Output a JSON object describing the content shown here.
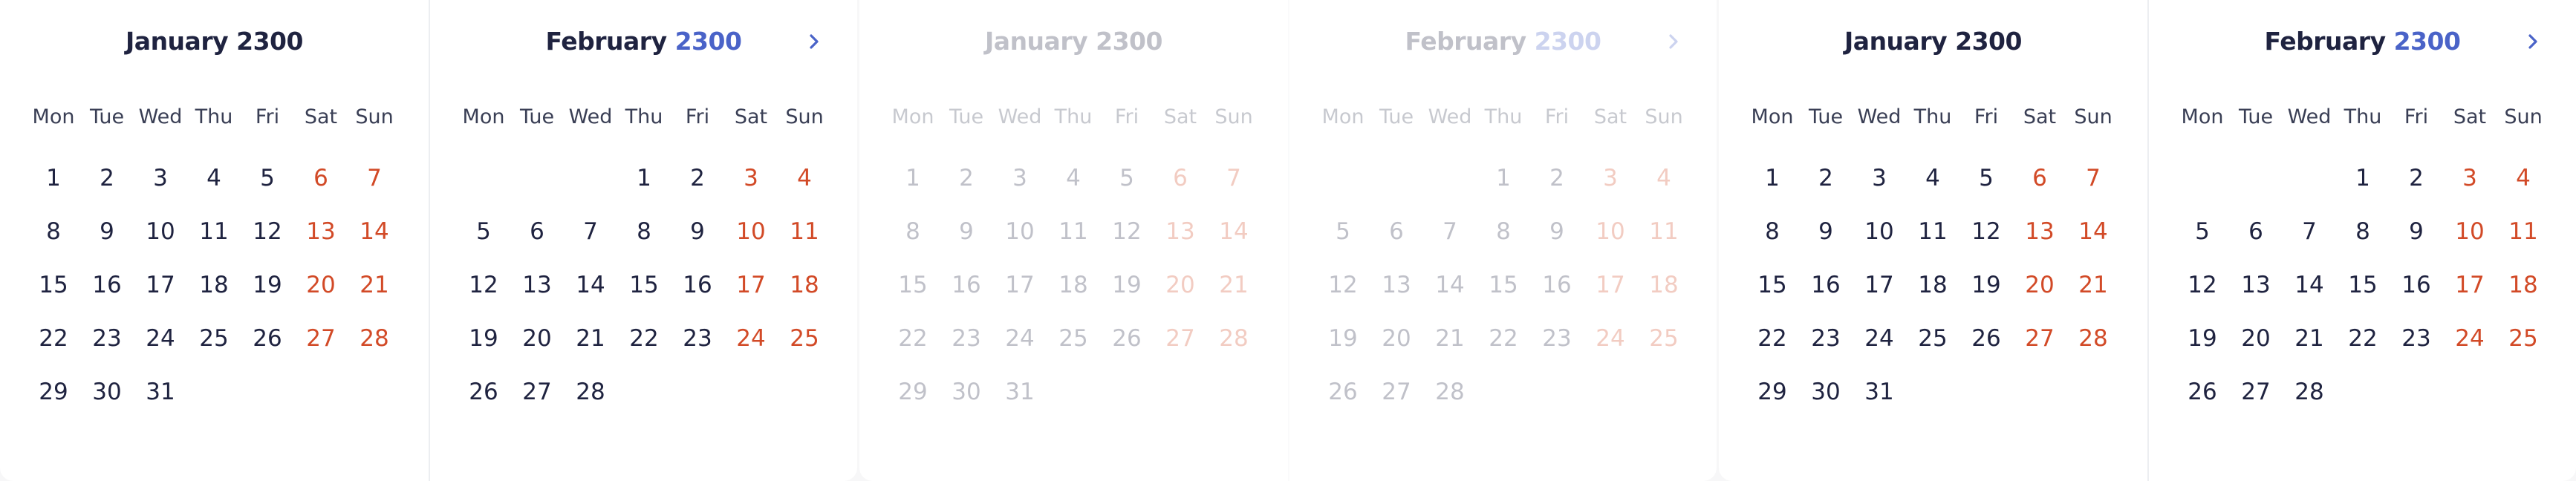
{
  "weekdays": [
    "Mon",
    "Tue",
    "Wed",
    "Thu",
    "Fri",
    "Sat",
    "Sun"
  ],
  "months": {
    "jan": {
      "name": "January",
      "year": "2300",
      "offset": 0,
      "days": 31
    },
    "feb": {
      "name": "February",
      "year": "2300",
      "offset": 3,
      "days": 28
    }
  },
  "icons": {
    "next": "chevron-right-icon"
  },
  "colors": {
    "weekend": "#d24a27",
    "accent": "#4a63c8",
    "text": "#1f2340"
  }
}
